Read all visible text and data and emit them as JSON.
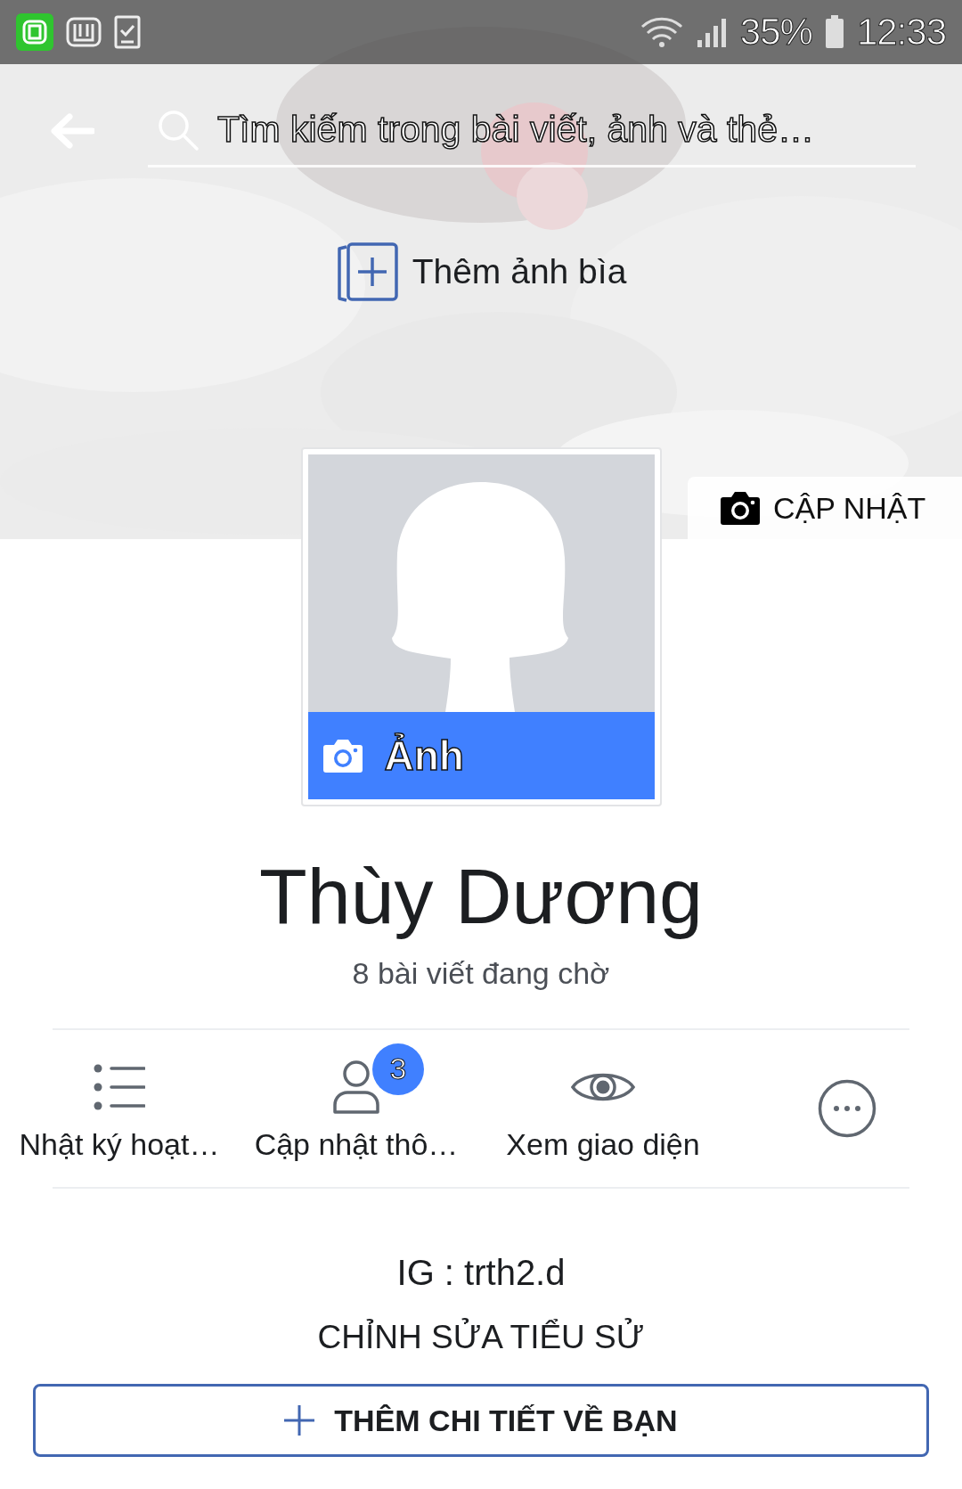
{
  "status_bar": {
    "battery": "35%",
    "time": "12:33"
  },
  "search": {
    "placeholder": "Tìm kiếm trong bài viết, ảnh và thẻ…"
  },
  "cover": {
    "add_label": "Thêm ảnh bìa",
    "update_label": "CẬP NHẬT"
  },
  "profile_photo": {
    "label": "Ảnh"
  },
  "name": "Thùy Dương",
  "subtitle": "8 bài viết đang chờ",
  "actions": [
    {
      "kind": "activity",
      "label": "Nhật ký hoạt…"
    },
    {
      "kind": "friends",
      "label": "Cập nhật thô…",
      "badge": "3"
    },
    {
      "kind": "view",
      "label": "Xem giao diện"
    },
    {
      "kind": "more"
    }
  ],
  "bio": "IG : trth2.d",
  "edit_bio": "CHỈNH SỬA TIỂU SỬ",
  "add_details_button": "THÊM CHI TIẾT VỀ BẠN"
}
